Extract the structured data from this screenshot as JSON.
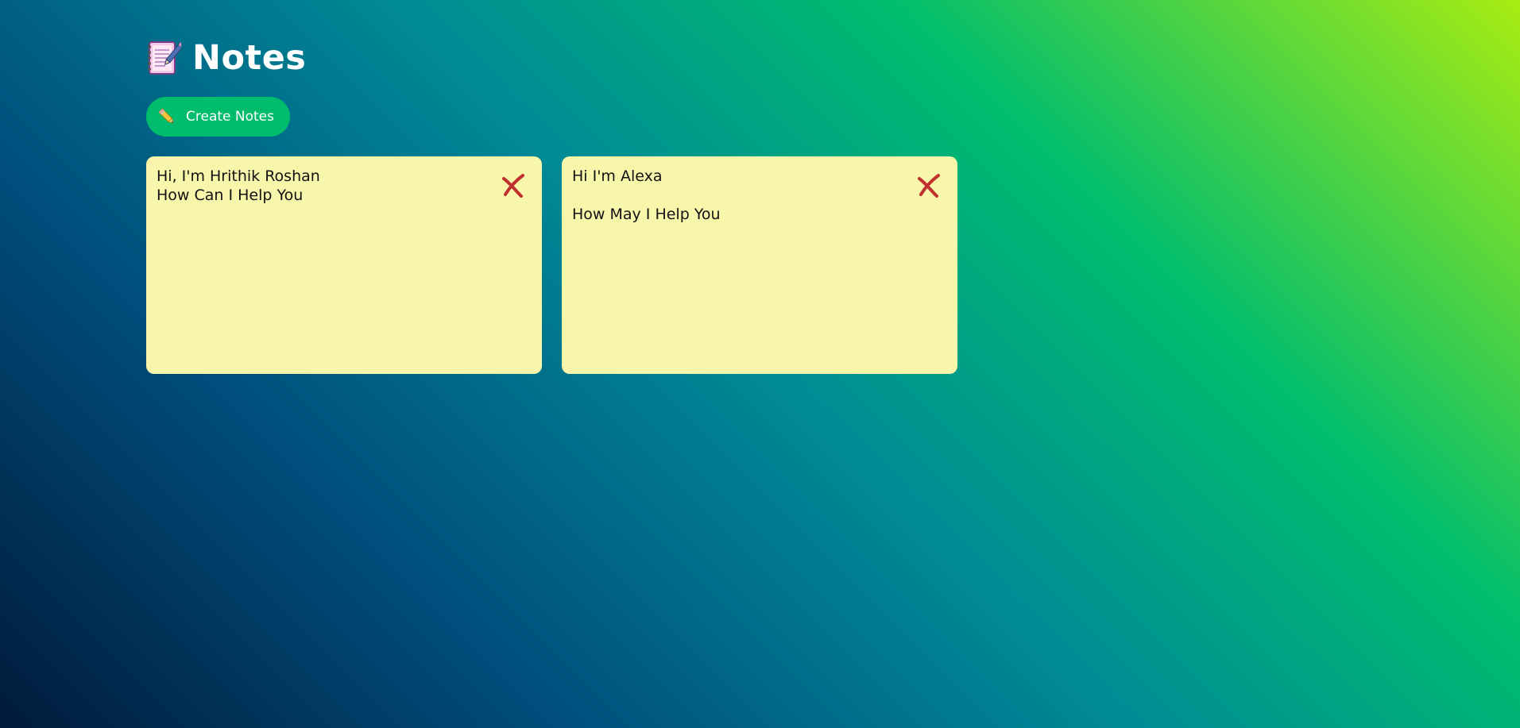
{
  "header": {
    "icon": "notebook-icon",
    "title": "Notes"
  },
  "toolbar": {
    "create_icon": "pencil-icon",
    "create_label": "Create Notes",
    "create_color": "#00bd6e"
  },
  "notes": [
    {
      "text": "Hi, I'm Hrithik Roshan\nHow Can I Help You",
      "delete_icon": "delete-icon"
    },
    {
      "text": "Hi I'm Alexa\n\nHow May I Help You",
      "delete_icon": "delete-icon"
    }
  ],
  "colors": {
    "note_background": "#f8f6ab",
    "delete_icon": "#c0302e"
  }
}
